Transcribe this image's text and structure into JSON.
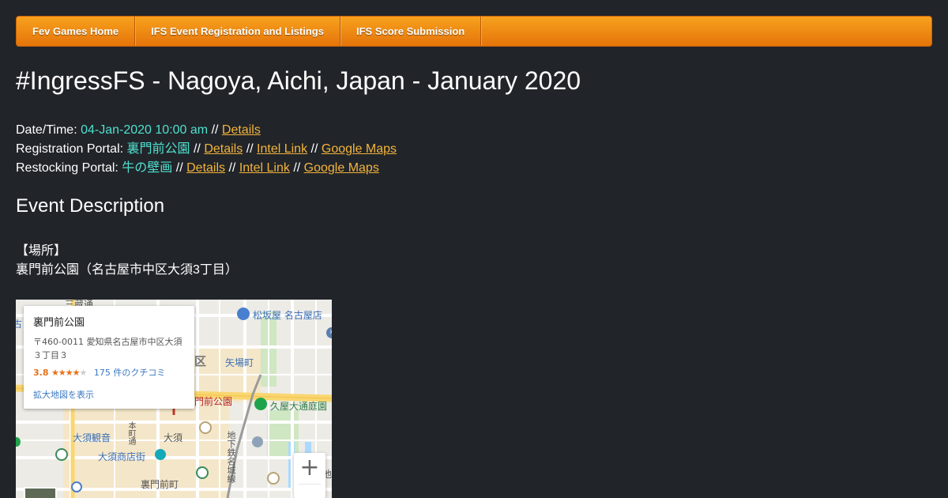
{
  "nav": {
    "items": [
      {
        "label": "Fev Games Home"
      },
      {
        "label": "IFS Event Registration and Listings"
      },
      {
        "label": "IFS Score Submission"
      }
    ]
  },
  "page_title": "#IngressFS - Nagoya, Aichi, Japan - January 2020",
  "date_row": {
    "label": "Date/Time:",
    "value": "04-Jan-2020 10:00 am",
    "sep": "//",
    "details": "Details"
  },
  "registration_row": {
    "label": "Registration Portal:",
    "portal": "裏門前公園",
    "sep": "//",
    "details": "Details",
    "intel": "Intel Link",
    "maps": "Google Maps"
  },
  "restocking_row": {
    "label": "Restocking Portal:",
    "portal": "牛の壁画",
    "sep": "//",
    "details": "Details",
    "intel": "Intel Link",
    "maps": "Google Maps"
  },
  "section_heading": "Event Description",
  "description": {
    "line1": "【場所】",
    "line2": "裏門前公園（名古屋市中区大須3丁目）"
  },
  "map": {
    "card": {
      "title": "裏門前公園",
      "address": "〒460-0011 愛知県名古屋市中区大須３丁目３",
      "rating": "3.8",
      "stars_on": "★★★★",
      "stars_off": "★",
      "reviews": "175 件のクチコミ",
      "link": "拡大地図を表示"
    },
    "labels": {
      "matsuzakaya": "松坂屋 名古屋店",
      "yabacho": "矢場町",
      "ura_park": "門前公園",
      "hisaya": "久屋大通庭園",
      "osu_kannon": "大須観音",
      "osu": "大須",
      "osu_shotengai": "大須商店街",
      "uramonzen": "裏門前町",
      "ward": "区",
      "subway": "地下鉄名城線",
      "honmachi": "本町通",
      "top_street": "三蔵通",
      "pond": "池",
      "left_edge": "古"
    },
    "zoom_in": "+",
    "close": "×"
  },
  "colors": {
    "background": "#212429",
    "nav_gradient_top": "#f7a21e",
    "nav_gradient_bottom": "#e5740a",
    "accent_cyan": "#4fe0ce",
    "link_gold": "#f3b43c"
  }
}
